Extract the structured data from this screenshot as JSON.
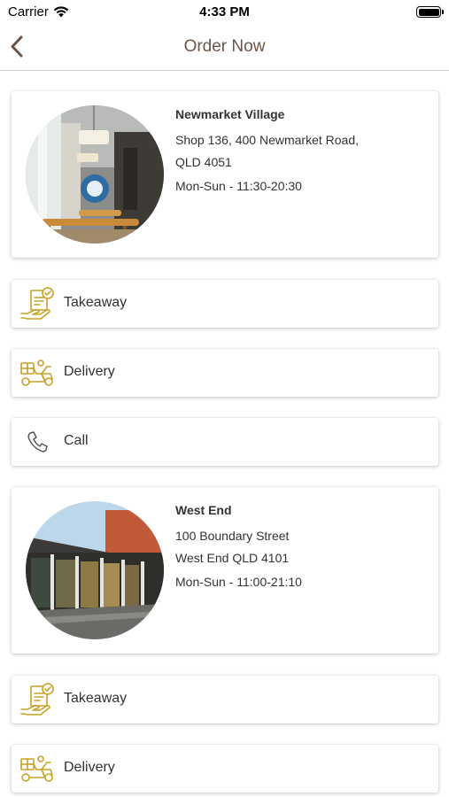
{
  "status_bar": {
    "carrier": "Carrier",
    "time": "4:33 PM"
  },
  "nav": {
    "title": "Order Now",
    "back_icon": "chevron-left-icon"
  },
  "colors": {
    "accent": "#c9a227",
    "title": "#6b5548",
    "text": "#333333"
  },
  "stores": [
    {
      "name": "Newmarket Village",
      "address_line1": "Shop 136, 400 Newmarket Road,",
      "address_line2": "QLD 4051",
      "hours": "Mon-Sun - 11:30-20:30",
      "actions": [
        {
          "label": "Takeaway",
          "icon": "takeaway-icon"
        },
        {
          "label": "Delivery",
          "icon": "delivery-scooter-icon"
        },
        {
          "label": "Call",
          "icon": "phone-icon"
        }
      ]
    },
    {
      "name": "West End",
      "address_line1": "100 Boundary Street",
      "address_line2": "West End QLD 4101",
      "hours": "Mon-Sun - 11:00-21:10",
      "actions": [
        {
          "label": "Takeaway",
          "icon": "takeaway-icon"
        },
        {
          "label": "Delivery",
          "icon": "delivery-scooter-icon"
        }
      ]
    }
  ]
}
